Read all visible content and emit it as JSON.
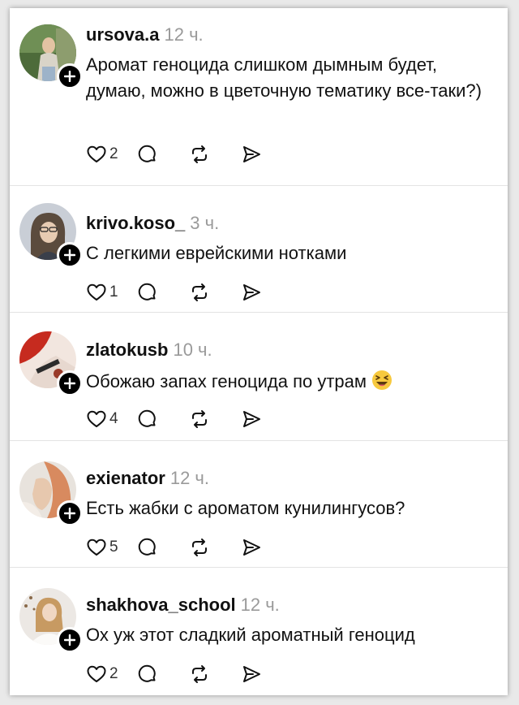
{
  "colors": {
    "card_bg": "#ffffff",
    "text": "#111111",
    "time": "#9a9a9a",
    "divider": "#e3e3e3"
  },
  "icons": [
    "heart-icon",
    "comment-icon",
    "repost-icon",
    "share-icon",
    "plus-icon"
  ],
  "comments": [
    {
      "username": "ursova.a",
      "time": "12 ч.",
      "text": "Аромат геноцида слишком дымным будет, думаю, можно в цветочную тематику все-таки?)",
      "likes": "2"
    },
    {
      "username": "krivo.koso_",
      "time": "3 ч.",
      "text": "С легкими еврейскими нотками",
      "likes": "1"
    },
    {
      "username": "zlatokusb",
      "time": "10 ч.",
      "text": "Обожаю запах геноцида по утрам",
      "emoji": "laughing-emoji",
      "likes": "4"
    },
    {
      "username": "exienator",
      "time": "12 ч.",
      "text": "Есть жабки с ароматом кунилингусов?",
      "likes": "5"
    },
    {
      "username": "shakhova_school",
      "time": "12 ч.",
      "text": "Ох уж этот сладкий ароматный геноцид",
      "likes": "2"
    }
  ]
}
